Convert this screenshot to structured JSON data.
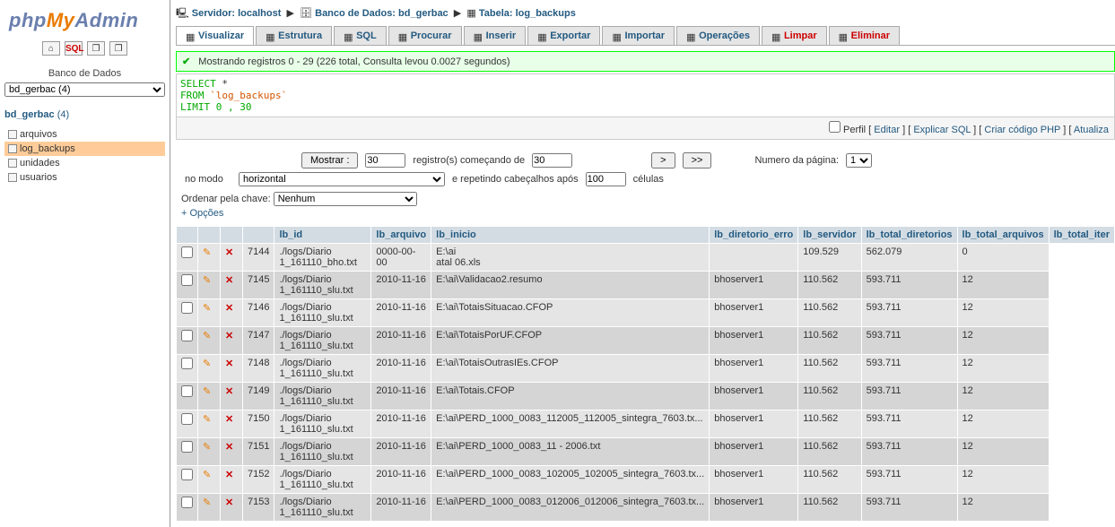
{
  "logo": {
    "php": "php",
    "my": "My",
    "admin": "Admin"
  },
  "sidebar": {
    "db_label": "Banco de Dados",
    "db_select": "bd_gerbac (4)",
    "db_link": "bd_gerbac",
    "db_count": "(4)",
    "tables": [
      "arquivos",
      "log_backups",
      "unidades",
      "usuarios"
    ],
    "selected_table": "log_backups"
  },
  "breadcrumb": {
    "server_label": "Servidor:",
    "server": "localhost",
    "db_label": "Banco de Dados:",
    "db": "bd_gerbac",
    "table_label": "Tabela:",
    "table": "log_backups"
  },
  "tabs": [
    {
      "label": "Visualizar",
      "active": true
    },
    {
      "label": "Estrutura"
    },
    {
      "label": "SQL"
    },
    {
      "label": "Procurar"
    },
    {
      "label": "Inserir"
    },
    {
      "label": "Exportar"
    },
    {
      "label": "Importar"
    },
    {
      "label": "Operações"
    },
    {
      "label": "Limpar",
      "red": true
    },
    {
      "label": "Eliminar",
      "red": true
    }
  ],
  "success_msg": "Mostrando registros 0 - 29 (226 total, Consulta levou 0.0027 segundos)",
  "sql": {
    "l1a": "SELECT",
    "l1b": " *",
    "l2a": "FROM",
    "l2b": " `log_backups`",
    "l3a": "LIMIT",
    "l3b": " 0 , 30"
  },
  "sql_actions": {
    "profile_chk": "Perfil",
    "edit": "Editar",
    "explain": "Explicar SQL",
    "php": "Criar código PHP",
    "refresh": "Atualiza"
  },
  "controls": {
    "show_btn": "Mostrar :",
    "show_val": "30",
    "rows_from": "registro(s) começando de",
    "start_val": "30",
    "nav1": ">",
    "nav2": ">>",
    "page_label": "Numero da página:",
    "page_val": "1",
    "mode_label": "no modo",
    "mode_val": "horizontal",
    "repeat_label": "e repetindo cabeçalhos após",
    "repeat_val": "100",
    "cells": "células",
    "sort_label": "Ordenar pela chave:",
    "sort_val": "Nenhum",
    "options": "+ Opções"
  },
  "columns": [
    "lb_id",
    "lb_arquivo",
    "lb_inicio",
    "lb_diretorio_erro",
    "lb_servidor",
    "lb_total_diretorios",
    "lb_total_arquivos",
    "lb_total_iter"
  ],
  "rows": [
    {
      "lb_id": "7144",
      "lb_arquivo": "./logs/Diario 1_161110_bho.txt",
      "lb_inicio": "0000-00-00",
      "lb_diretorio_erro": "E:\\ai\n atal 06.xls",
      "lb_servidor": "",
      "lb_total_diretorios": "109.529",
      "lb_total_arquivos": "562.079",
      "lb_total_iter": "0"
    },
    {
      "lb_id": "7145",
      "lb_arquivo": "./logs/Diario 1_161110_slu.txt",
      "lb_inicio": "2010-11-16",
      "lb_diretorio_erro": "E:\\ai\\Validacao2.resumo",
      "lb_servidor": "bhoserver1",
      "lb_total_diretorios": "110.562",
      "lb_total_arquivos": "593.711",
      "lb_total_iter": "12"
    },
    {
      "lb_id": "7146",
      "lb_arquivo": "./logs/Diario 1_161110_slu.txt",
      "lb_inicio": "2010-11-16",
      "lb_diretorio_erro": "E:\\ai\\TotaisSituacao.CFOP",
      "lb_servidor": "bhoserver1",
      "lb_total_diretorios": "110.562",
      "lb_total_arquivos": "593.711",
      "lb_total_iter": "12"
    },
    {
      "lb_id": "7147",
      "lb_arquivo": "./logs/Diario 1_161110_slu.txt",
      "lb_inicio": "2010-11-16",
      "lb_diretorio_erro": "E:\\ai\\TotaisPorUF.CFOP",
      "lb_servidor": "bhoserver1",
      "lb_total_diretorios": "110.562",
      "lb_total_arquivos": "593.711",
      "lb_total_iter": "12"
    },
    {
      "lb_id": "7148",
      "lb_arquivo": "./logs/Diario 1_161110_slu.txt",
      "lb_inicio": "2010-11-16",
      "lb_diretorio_erro": "E:\\ai\\TotaisOutrasIEs.CFOP",
      "lb_servidor": "bhoserver1",
      "lb_total_diretorios": "110.562",
      "lb_total_arquivos": "593.711",
      "lb_total_iter": "12"
    },
    {
      "lb_id": "7149",
      "lb_arquivo": "./logs/Diario 1_161110_slu.txt",
      "lb_inicio": "2010-11-16",
      "lb_diretorio_erro": "E:\\ai\\Totais.CFOP",
      "lb_servidor": "bhoserver1",
      "lb_total_diretorios": "110.562",
      "lb_total_arquivos": "593.711",
      "lb_total_iter": "12"
    },
    {
      "lb_id": "7150",
      "lb_arquivo": "./logs/Diario 1_161110_slu.txt",
      "lb_inicio": "2010-11-16",
      "lb_diretorio_erro": "E:\\ai\\PERD_1000_0083_112005_112005_sintegra_7603.tx...",
      "lb_servidor": "bhoserver1",
      "lb_total_diretorios": "110.562",
      "lb_total_arquivos": "593.711",
      "lb_total_iter": "12"
    },
    {
      "lb_id": "7151",
      "lb_arquivo": "./logs/Diario 1_161110_slu.txt",
      "lb_inicio": "2010-11-16",
      "lb_diretorio_erro": "E:\\ai\\PERD_1000_0083_11 - 2006.txt",
      "lb_servidor": "bhoserver1",
      "lb_total_diretorios": "110.562",
      "lb_total_arquivos": "593.711",
      "lb_total_iter": "12"
    },
    {
      "lb_id": "7152",
      "lb_arquivo": "./logs/Diario 1_161110_slu.txt",
      "lb_inicio": "2010-11-16",
      "lb_diretorio_erro": "E:\\ai\\PERD_1000_0083_102005_102005_sintegra_7603.tx...",
      "lb_servidor": "bhoserver1",
      "lb_total_diretorios": "110.562",
      "lb_total_arquivos": "593.711",
      "lb_total_iter": "12"
    },
    {
      "lb_id": "7153",
      "lb_arquivo": "./logs/Diario 1_161110_slu.txt",
      "lb_inicio": "2010-11-16",
      "lb_diretorio_erro": "E:\\ai\\PERD_1000_0083_012006_012006_sintegra_7603.tx...",
      "lb_servidor": "bhoserver1",
      "lb_total_diretorios": "110.562",
      "lb_total_arquivos": "593.711",
      "lb_total_iter": "12"
    }
  ]
}
